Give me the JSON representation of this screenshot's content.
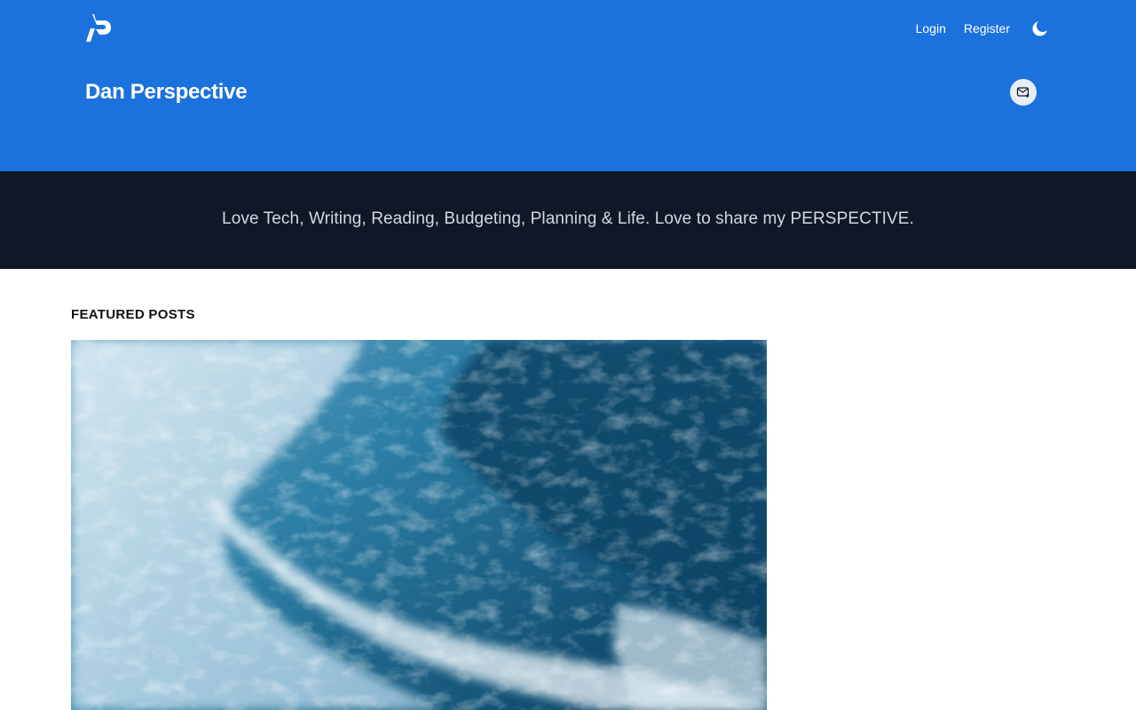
{
  "header": {
    "logo_icon": "hashnode-style-logo-icon",
    "nav": {
      "login_label": "Login",
      "register_label": "Register",
      "theme_toggle_icon": "moon-icon"
    },
    "blog_title": "Dan Perspective",
    "newsletter_icon": "mail-plus-icon"
  },
  "description": "Love Tech, Writing, Reading, Budgeting, Planning & Life. Love to share my PERSPECTIVE.",
  "featured": {
    "heading": "FEATURED POSTS",
    "image_subject": "aerial-ocean-wave-image"
  },
  "colors": {
    "header_blue": "#1b72dc",
    "band_dark": "#101828",
    "ocean_deep": "#0d4a6e",
    "ocean_light": "#bcd8e8"
  }
}
